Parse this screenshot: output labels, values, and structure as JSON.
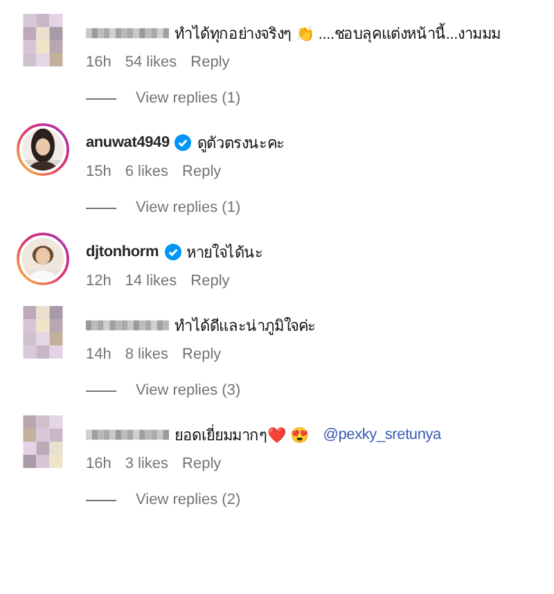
{
  "comments": [
    {
      "avatar": {
        "kind": "blurred"
      },
      "username": {
        "kind": "blurred"
      },
      "verified": false,
      "text": "ทำได้ทุกอย่างจริงๆ 👏 ....ชอบลุคแต่งหน้านี้...งามมม",
      "time": "16h",
      "likes": "54 likes",
      "reply": "Reply",
      "view_replies": "View replies (1)"
    },
    {
      "username": {
        "kind": "text",
        "text": "anuwat4949"
      },
      "verified": true,
      "text": "ดูตัวตรงนะคะ",
      "time": "15h",
      "likes": "6 likes",
      "reply": "Reply",
      "view_replies": "View replies (1)"
    },
    {
      "username": {
        "kind": "text",
        "text": "djtonhorm"
      },
      "verified": true,
      "text": "หายใจได้นะ",
      "time": "12h",
      "likes": "14 likes",
      "reply": "Reply"
    },
    {
      "avatar": {
        "kind": "blurred"
      },
      "username": {
        "kind": "blurred"
      },
      "verified": false,
      "text": "ทำได้ดีและน่าภูมิใจค่ะ",
      "time": "14h",
      "likes": "8 likes",
      "reply": "Reply",
      "view_replies": "View replies (3)"
    },
    {
      "avatar": {
        "kind": "blurred"
      },
      "username": {
        "kind": "blurred"
      },
      "verified": false,
      "text": "ยอดเยี่ยมมากๆ❤️ 😍",
      "mention": "@pexky_sretunya",
      "time": "16h",
      "likes": "3 likes",
      "reply": "Reply",
      "view_replies": "View replies (2)"
    }
  ]
}
